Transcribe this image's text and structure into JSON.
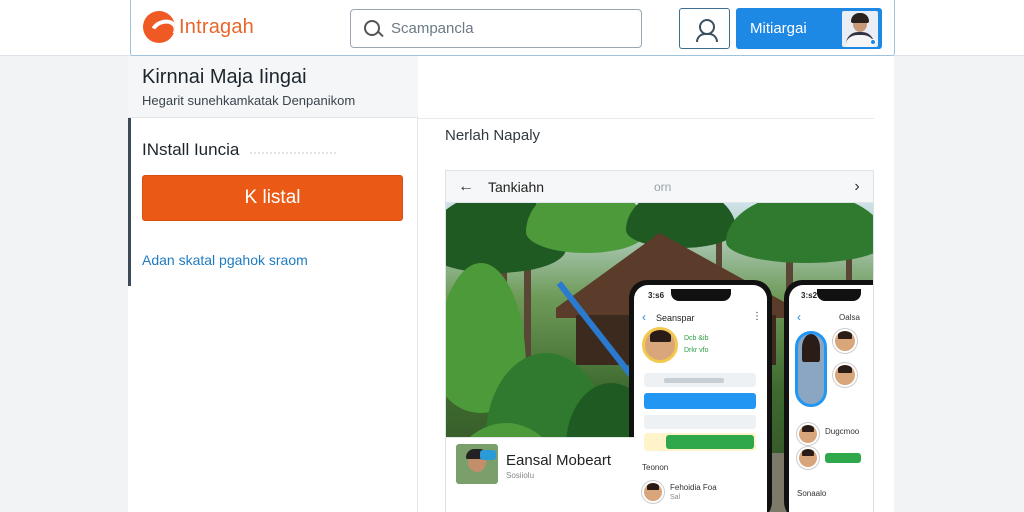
{
  "header": {
    "brand": "Intragah",
    "search_placeholder": "Scampancla",
    "account_label": "Mitiargai"
  },
  "app": {
    "title": "Kirnnai Maja Iingai",
    "subtitle": "Hegarit sunehkamkatak Denpanikom"
  },
  "install": {
    "heading": "INstall Iuncia",
    "button_label": "K listal",
    "help_link": "Adan skatal pgahok sraom"
  },
  "gallery": {
    "section_title": "Nerlah Napaly",
    "bar_title": "Tankiahn",
    "bar_count": "orn",
    "prev_icon": "chevron-left-icon",
    "next_icon": "chevron-right-icon"
  },
  "phone_left": {
    "status": "3:s6",
    "title": "Seanspar",
    "profile_name": "Dcb &ib",
    "profile_sub": "Drkr vfo",
    "section": "Teonon",
    "contact_name": "Fehoidia Foa",
    "contact_sub": "Sal"
  },
  "phone_right": {
    "status": "3:s2",
    "title": "Oalsa",
    "section": "Sonaalo",
    "contact_name": "Dugcmoo"
  },
  "card": {
    "title": "Eansal Mobeart",
    "subtitle": "Sosiiolu"
  },
  "colors": {
    "brand_orange": "#ea5a16",
    "primary_blue": "#1e88e5",
    "link_blue": "#1f7bc2"
  }
}
